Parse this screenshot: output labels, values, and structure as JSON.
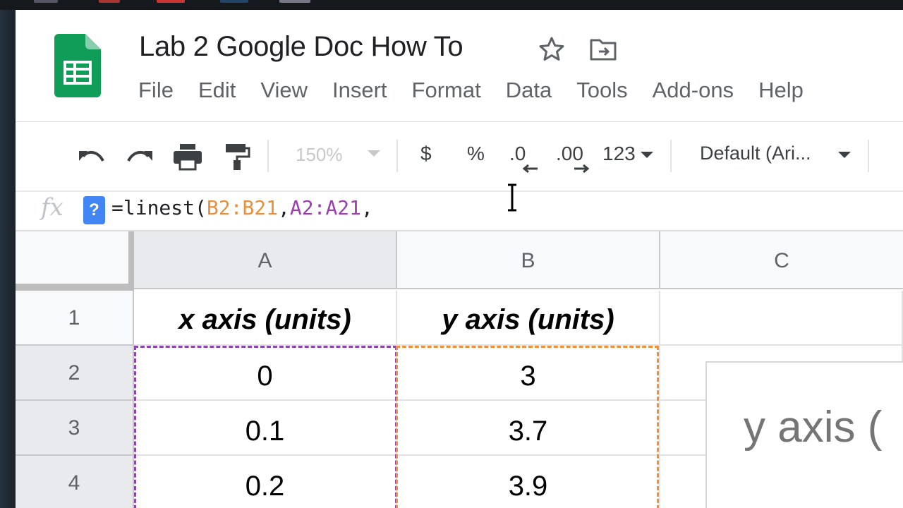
{
  "document": {
    "title": "Lab 2 Google Doc How To"
  },
  "menu": [
    "File",
    "Edit",
    "View",
    "Insert",
    "Format",
    "Data",
    "Tools",
    "Add-ons",
    "Help"
  ],
  "toolbar": {
    "zoom": "150%",
    "currency": "$",
    "percent": "%",
    "decrease_decimal": ".0",
    "increase_decimal": ".00",
    "number_format": "123",
    "font": "Default (Ari..."
  },
  "formula_bar": {
    "fx": "fx",
    "help": "?",
    "prefix": "=linest(",
    "range1": "B2:B21",
    "comma1": ",",
    "range2": "A2:A21",
    "suffix": ","
  },
  "grid": {
    "columns": [
      "A",
      "B",
      "C"
    ],
    "rows": [
      {
        "num": "1",
        "a": "x axis (units)",
        "b": "y axis (units)"
      },
      {
        "num": "2",
        "a": "0",
        "b": "3"
      },
      {
        "num": "3",
        "a": "0.1",
        "b": "3.7"
      },
      {
        "num": "4",
        "a": "0.2",
        "b": "3.9"
      }
    ]
  },
  "chart": {
    "title": "y axis ("
  },
  "colors": {
    "range_a": "#8e44ad",
    "range_b": "#f0913a",
    "sheets_green": "#0f9d58",
    "help_blue": "#4285f4"
  }
}
